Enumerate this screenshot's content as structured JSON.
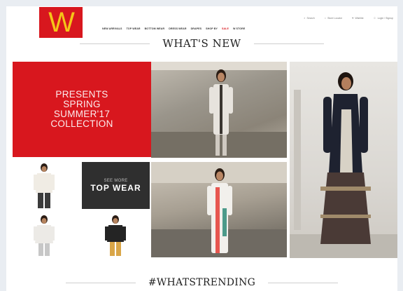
{
  "brand": {
    "logo_letter": "W",
    "color": "#d8171e",
    "logo_text_color": "#f5c518"
  },
  "utility_links": [
    {
      "icon": "search-icon",
      "label": "Search"
    },
    {
      "icon": "store-icon",
      "label": "Store Locator"
    },
    {
      "icon": "heart-icon",
      "label": "Wishlist"
    },
    {
      "icon": "user-icon",
      "label": "Login / Signup"
    }
  ],
  "nav": {
    "items": [
      {
        "label": "NEW ARRIVALS"
      },
      {
        "label": "TOP WEAR"
      },
      {
        "label": "BOTTOM WEAR"
      },
      {
        "label": "DRESS WEAR"
      },
      {
        "label": "DRAPES"
      },
      {
        "label": "SHOP BY"
      },
      {
        "label": "SALE",
        "highlight": true
      },
      {
        "label": "W STORE"
      }
    ]
  },
  "sections": {
    "whats_new": "WHAT'S NEW",
    "trending": "#WHATSTRENDING"
  },
  "promo": {
    "text": "PRESENTS\nSPRING\nSUMMER'17\nCOLLECTION"
  },
  "top_wear_panel": {
    "small": "SEE MORE",
    "big": "TOP WEAR"
  }
}
